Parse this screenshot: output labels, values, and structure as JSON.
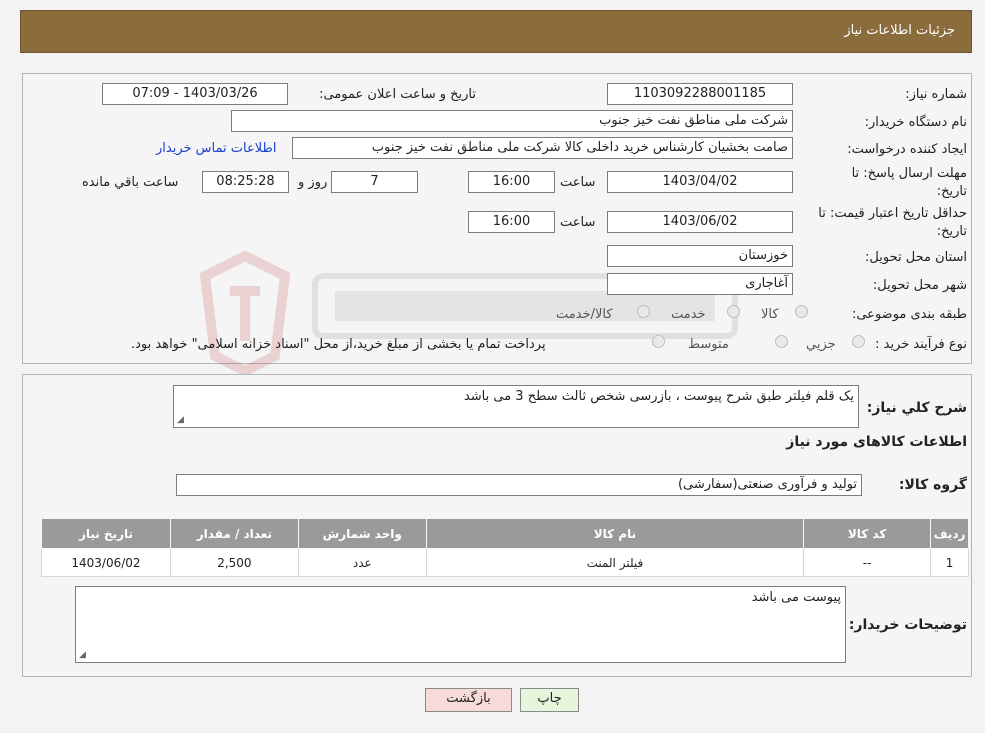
{
  "window": {
    "title": "جزئیات اطلاعات نیاز"
  },
  "form": {
    "need_number": {
      "label": "شماره نیاز:",
      "value": "1103092288001185"
    },
    "announce_datetime": {
      "label": "تاریخ و ساعت اعلان عمومی:",
      "value": "1403/03/26 - 07:09"
    },
    "buyer_org": {
      "label": "نام دستگاه خریدار:",
      "value": "شرکت ملی مناطق نفت خیز جنوب"
    },
    "requester": {
      "label": "ایجاد کننده درخواست:",
      "value": "صامت  بخشیان  کارشناس خرید داخلی کالا  شرکت ملی مناطق نفت خیز جنوب",
      "contact_link": "اطلاعات تماس خریدار"
    },
    "reply_deadline": {
      "label_line1": "مهلت ارسال پاسخ: تا",
      "label_line2": "تاریخ:",
      "date": "1403/04/02",
      "time_label": "ساعت",
      "time": "16:00",
      "days": "7",
      "days_label": "روز و",
      "remaining": "08:25:28",
      "remaining_label": "ساعت باقي مانده"
    },
    "price_validity": {
      "label_line1": "حداقل تاریخ اعتبار قیمت: تا",
      "label_line2": "تاریخ:",
      "date": "1403/06/02",
      "time_label": "ساعت",
      "time": "16:00"
    },
    "province": {
      "label": "استان محل تحویل:",
      "value": "خوزستان"
    },
    "city": {
      "label": "شهر محل تحویل:",
      "value": "آغاجاری"
    },
    "category": {
      "label": "طبقه بندی موضوعی:",
      "options": [
        "کالا",
        "خدمت",
        "کالا/خدمت"
      ]
    },
    "process_type": {
      "label": "نوع فرآیند خرید :",
      "options": [
        "جزیي",
        "متوسط"
      ],
      "note": "پرداخت تمام یا بخشی از مبلغ خرید،از محل \"اسناد خزانه اسلامی\" خواهد بود."
    }
  },
  "details": {
    "general_desc_label": "شرح کلي نياز:",
    "general_desc": "یک قلم فیلتر طبق شرح پیوست ، بازرسی شخص ثالث سطح 3 می باشد",
    "items_heading": "اطلاعات کالاهای مورد نیاز",
    "goods_group_label": "گروه کالا:",
    "goods_group": "تولید و فرآوری صنعتی(سفارشی)",
    "table": {
      "headers": [
        "ردیف",
        "کد کالا",
        "نام کالا",
        "واحد شمارش",
        "تعداد / مقدار",
        "تاریخ نیاز"
      ],
      "rows": [
        [
          "1",
          "--",
          "فیلتر المنت",
          "عدد",
          "2,500",
          "1403/06/02"
        ]
      ]
    },
    "buyer_notes_label": "توضیحات خریدار:",
    "buyer_notes": "پیوست می باشد"
  },
  "buttons": {
    "print": "چاپ",
    "back": "بازگشت"
  },
  "colors": {
    "header": "#8b6c3d",
    "table_header": "#9a9a9a",
    "link": "#1a3fd0",
    "back_button": "#f7dada",
    "print_button": "#e6f5dc"
  }
}
